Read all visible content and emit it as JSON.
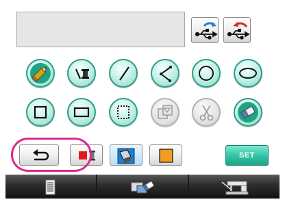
{
  "display": {
    "text": ""
  },
  "usb_buttons": [
    {
      "name": "usb-import",
      "icon": "usb-import-icon",
      "arrow_color": "#2a7bd4"
    },
    {
      "name": "usb-export",
      "icon": "usb-export-icon",
      "arrow_color": "#d62828"
    }
  ],
  "tools_row1": [
    "pencil-icon",
    "line-thread-icon",
    "line-icon",
    "polyline-icon",
    "circle-icon",
    "ellipse-icon"
  ],
  "tools_row2": [
    "square-icon",
    "rectangle-icon",
    "dotted-selection-icon",
    "copy-icon",
    "scissors-icon",
    "eraser-icon"
  ],
  "disabled_tools": [
    "copy-icon",
    "scissors-icon"
  ],
  "bottom": {
    "set_label": "SET",
    "set_color": "#34c4a7"
  },
  "colors": {
    "accent": "#2f9e87",
    "highlight": "#e0288a",
    "thread_red": "#e01b1b",
    "fill_orange": "#f39c1f"
  },
  "tabs": [
    "document-icon",
    "stitch-edit-icon",
    "sewing-machine-icon"
  ]
}
